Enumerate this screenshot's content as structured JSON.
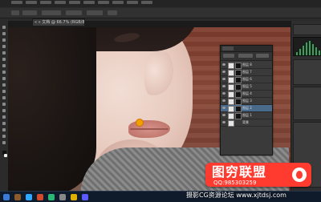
{
  "app": {
    "document_tab": "« » 文档 @ 66.7% (RGB/8)"
  },
  "layers_panel": {
    "rows": [
      {
        "label": "图层 8"
      },
      {
        "label": "图层 7"
      },
      {
        "label": "图层 6"
      },
      {
        "label": "图层 5"
      },
      {
        "label": "图层 4"
      },
      {
        "label": "图层 3"
      },
      {
        "label": "图层 2",
        "selected": true
      },
      {
        "label": "图层 1"
      },
      {
        "label": "背景"
      }
    ]
  },
  "watermark": {
    "brand": "图穷联盟",
    "qq": "QQ:985303259",
    "site": "摄影CG资源论坛 www.xjtdsj.com"
  },
  "colors": {
    "accent": "#ff3b2f",
    "selected_layer": "#4a6a8c",
    "brush_cursor": "#f0a000"
  },
  "icons": [
    "eye-icon",
    "flame-icon",
    "brush-cursor-icon"
  ]
}
